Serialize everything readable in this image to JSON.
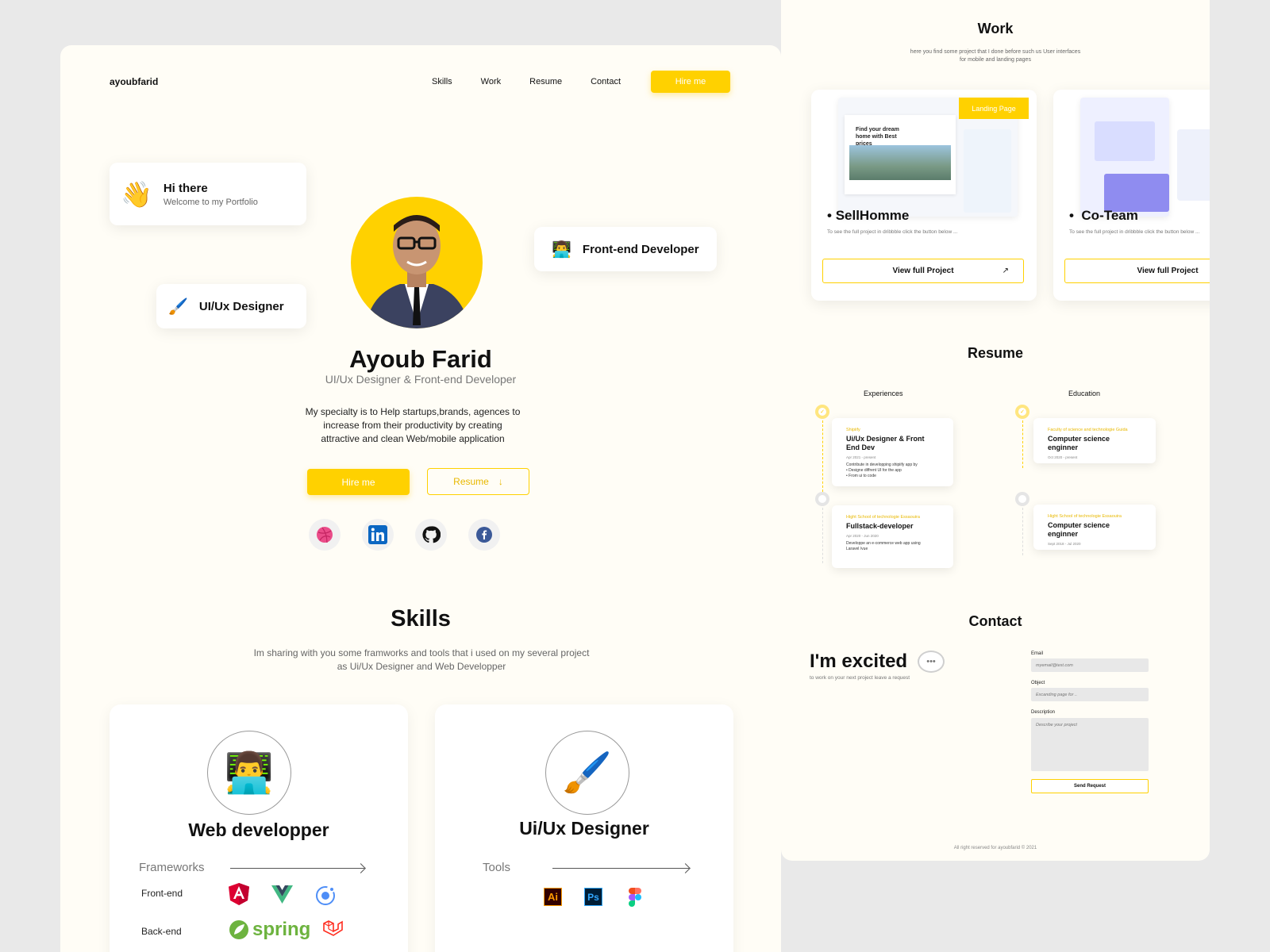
{
  "nav": {
    "logo": "ayoubfarid",
    "links": [
      "Skills",
      "Work",
      "Resume",
      "Contact"
    ],
    "hire": "Hire me"
  },
  "hero": {
    "hi_title": "Hi there",
    "hi_sub": "Welcome to my Portfolio",
    "badge_frontend": "Front-end Developer",
    "badge_ux": "UI/Ux Designer",
    "name": "Ayoub Farid",
    "role": "UI/Ux Designer & Front-end Developer",
    "desc_lines": [
      "My specialty is to Help startups,brands, agences to",
      "increase from their productivity  by creating",
      "attractive and clean Web/mobile application"
    ],
    "hire": "Hire me",
    "resume": "Resume"
  },
  "socials": [
    "dribbble-icon",
    "linkedin-icon",
    "github-icon",
    "facebook-icon"
  ],
  "skills": {
    "title": "Skills",
    "sub_lines": [
      "Im sharing with you some framworks and tools that i used on my several project",
      "as Ui/Ux Designer and Web Developper"
    ],
    "web": {
      "name": "Web developper",
      "section": "Frameworks",
      "frontend": "Front-end",
      "backend": "Back-end",
      "spring": "spring"
    },
    "ux": {
      "name": "Ui/Ux Designer",
      "section": "Tools",
      "ai": "Ai",
      "ps": "Ps"
    }
  },
  "work": {
    "title": "Work",
    "sub_lines": [
      "here you find some project that I done before such us User interfaces",
      "for mobile and landing pages"
    ],
    "badge": "Landing Page",
    "projects": [
      {
        "title": "SellHomme",
        "sub": "To see the full project in dribbble click the button below ...",
        "button": "View full Project",
        "shot_text": "Find your dream home with Best prices"
      },
      {
        "title": "Co-Team",
        "sub": "To see the full project in dribbble click the button below ...",
        "button": "View full Project"
      }
    ]
  },
  "resume": {
    "title": "Resume",
    "experiences_head": "Experiences",
    "education_head": "Education",
    "experiences": [
      {
        "org": "Shipiify",
        "role": "Ui/Ux Designer & Front End Dev",
        "date": "Apr 2021 - present",
        "desc": [
          "Contribute in developping shipiify app by",
          "•  Designe diffrent UI for the app",
          "•  From ui to code"
        ]
      },
      {
        "org": "Hight School of technologie Essaouira",
        "role": "Fullstack-developer",
        "date": "Apr 2020 - Jun 2020",
        "desc": [
          "Developpe an e-commerce web app using",
          "Laravel /vue"
        ]
      }
    ],
    "education": [
      {
        "org": "Faculty of science and technologie Guida",
        "role": "Computer science enginner",
        "date": "Oct 2020 - present"
      },
      {
        "org": "Hight School of technologie Essaouira",
        "role": "Computer science enginner",
        "date": "Sept 2018 - Jul 2020"
      }
    ]
  },
  "contact": {
    "title": "Contact",
    "excited": "I'm excited",
    "excited_sub": "to work on your next project leave a request",
    "email_label": "Email",
    "email_placeholder": "myemail@test.com",
    "object_label": "Object",
    "object_placeholder": "Excanding page for ..",
    "desc_label": "Description",
    "desc_placeholder": "Describe your project",
    "send": "Send Request"
  },
  "footer": "All right reserved for ayoubfarid © 2021",
  "colors": {
    "accent": "#ffd100",
    "background": "#fffdf6",
    "canvas": "#e9e9e9"
  }
}
